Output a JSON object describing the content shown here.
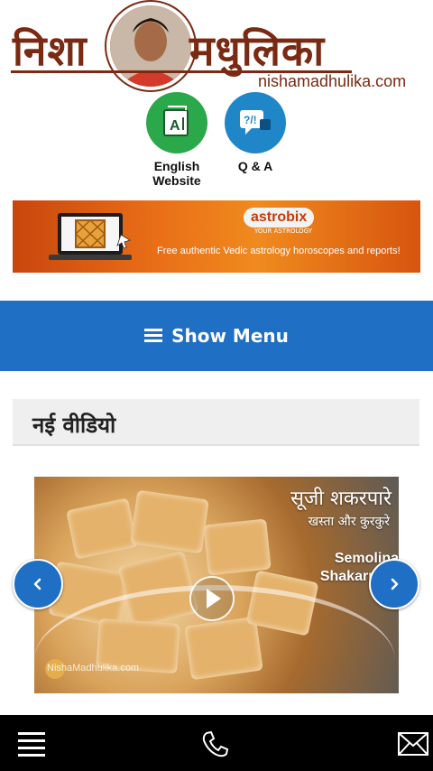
{
  "header": {
    "logo_part1": "निशा",
    "logo_part2": "मधुलिका",
    "domain": "nishamadhulika.com"
  },
  "quick_links": {
    "english": {
      "label_line1": "English",
      "label_line2": "Website",
      "icon": "translate-icon"
    },
    "qa": {
      "label": "Q & A",
      "icon": "question-chat-icon"
    }
  },
  "banner": {
    "brand": "astrobix",
    "brand_sub": "YOUR ASTROLOGY",
    "tagline": "Free authentic Vedic astrology horoscopes and reports!"
  },
  "menu": {
    "label": "Show Menu",
    "icon": "hamburger-icon"
  },
  "section": {
    "title": "नई वीडियो"
  },
  "video": {
    "title_hi": "सूजी शकरपारे",
    "subtitle_hi": "खस्ता और कुरकुरे",
    "title_en_line1": "Semolina",
    "title_en_line2": "Shakarpara",
    "watermark": "NishaMadhulika.com"
  },
  "bottom_bar": {
    "icons": [
      "menu-icon",
      "phone-icon",
      "mail-icon"
    ]
  },
  "colors": {
    "brand_maroon": "#7a2a12",
    "menu_blue": "#1f6fc4",
    "english_green": "#2aa84a",
    "qa_blue": "#1f87c8",
    "banner_orange": "#e96e17"
  }
}
